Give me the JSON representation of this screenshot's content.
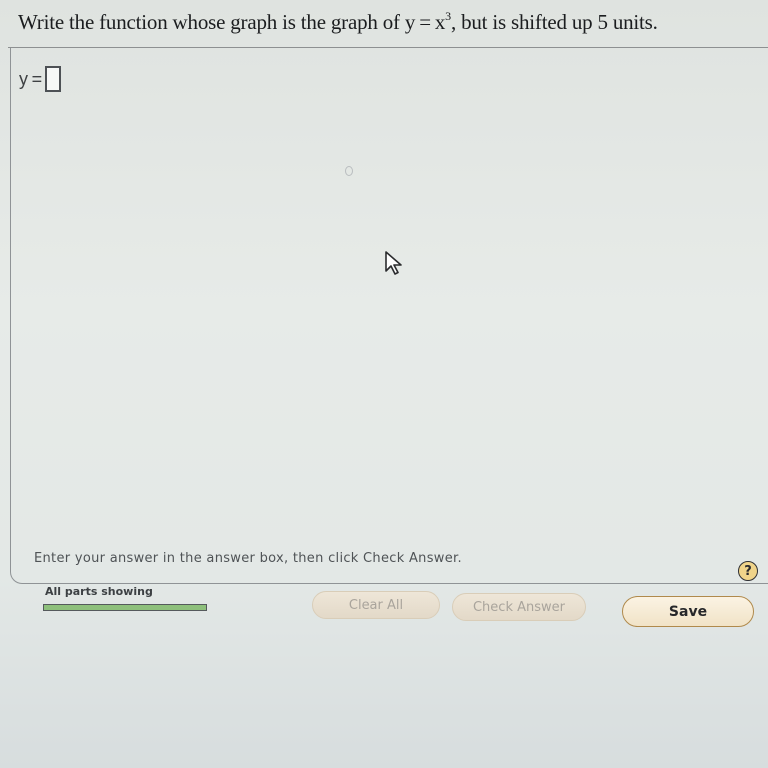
{
  "question": {
    "prefix": "Write the function whose graph is the graph of y = x",
    "exponent": "3",
    "suffix": ", but is shifted up 5 units."
  },
  "answer": {
    "label": "y =",
    "value": ""
  },
  "instruction": "Enter your answer in the answer box, then click Check Answer.",
  "help_icon": {
    "symbol": "?",
    "icon": "question-icon"
  },
  "progress": {
    "label": "All parts showing",
    "fraction": 1.0
  },
  "buttons": {
    "clear_all": "Clear All",
    "check_answer": "Check Answer",
    "save": "Save"
  },
  "colors": {
    "background": "#e5e9e6",
    "progress_fill": "#8ec07c",
    "save_border": "#b08a4c",
    "help_icon": "#f0d48a"
  }
}
